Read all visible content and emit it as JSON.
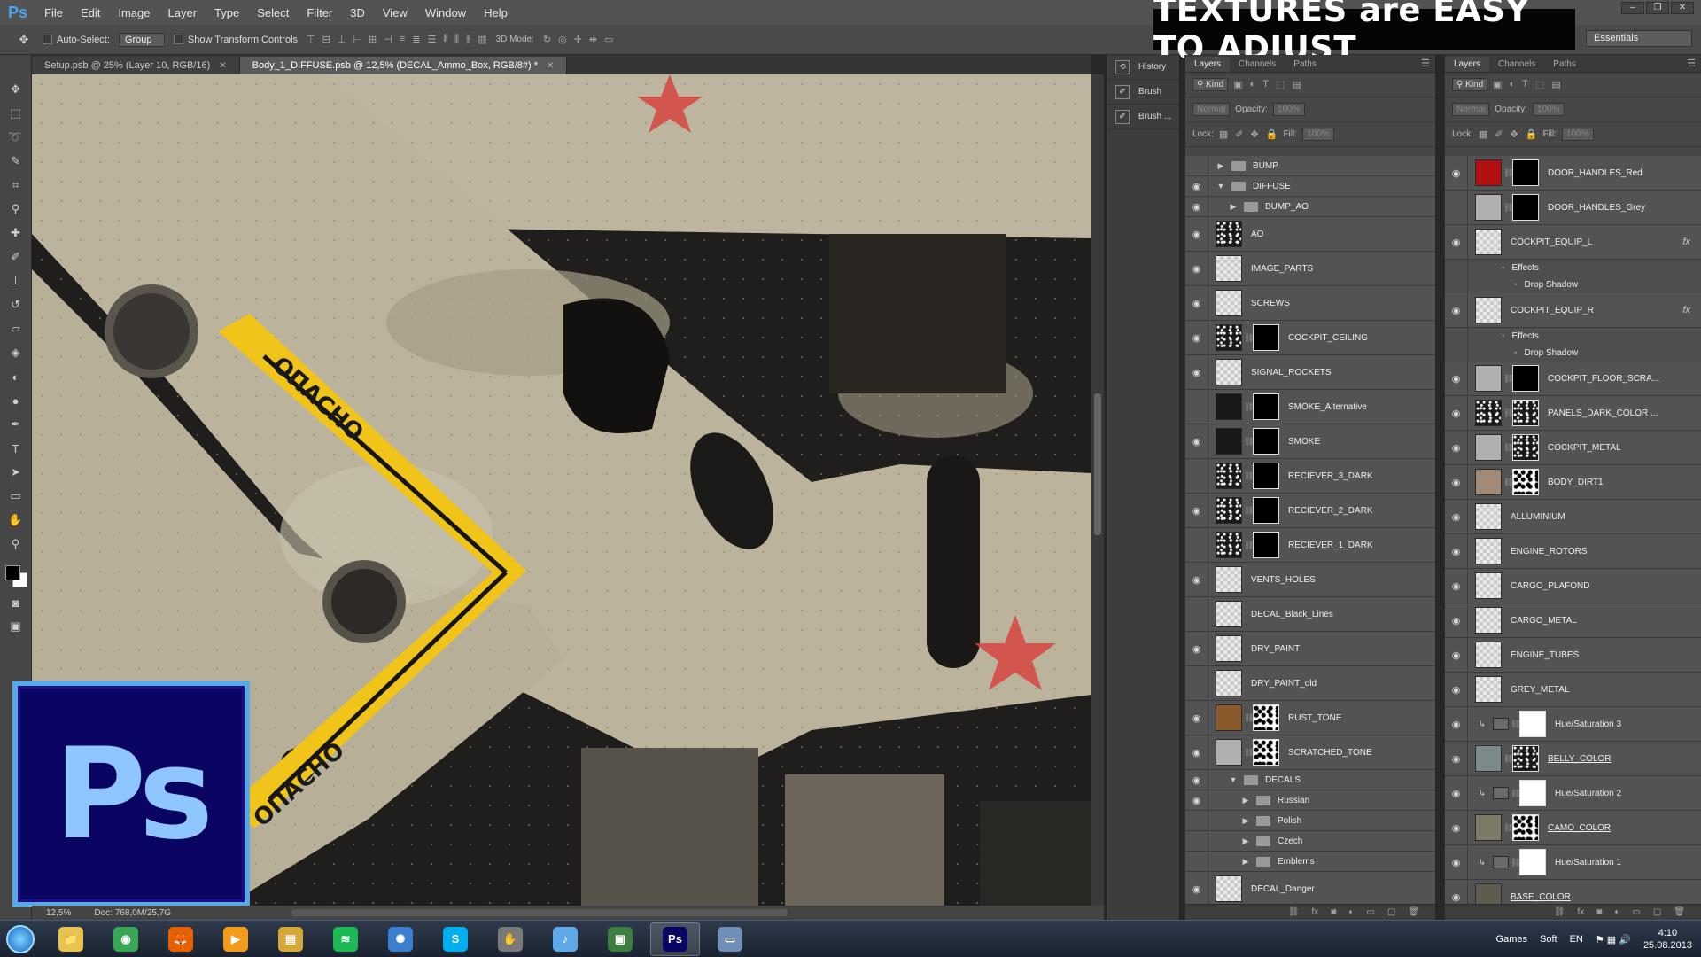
{
  "app": {
    "logo": "Ps"
  },
  "menubar": {
    "items": [
      "File",
      "Edit",
      "Image",
      "Layer",
      "Type",
      "Select",
      "Filter",
      "3D",
      "View",
      "Window",
      "Help"
    ]
  },
  "banner": {
    "text": "TEXTURES are EASY TO ADJUST"
  },
  "window_controls": {
    "minimize": "–",
    "restore": "❐",
    "close": "✕"
  },
  "options_bar": {
    "auto_select_label": "Auto-Select:",
    "auto_select_value": "Group",
    "show_transform_label": "Show Transform Controls",
    "mode_3d_label": "3D Mode:",
    "workspace": "Essentials"
  },
  "doc_tabs": [
    {
      "label": "Setup.psb @ 25% (Layer 10, RGB/16)",
      "active": false
    },
    {
      "label": "Body_1_DIFFUSE.psb @ 12,5% (DECAL_Ammo_Box, RGB/8#) *",
      "active": true
    }
  ],
  "canvas": {
    "stencil_top": "ОПАСНО",
    "stencil_bottom": "ОПАСНО",
    "colors": {
      "hull": "#bdb59f",
      "hull_dark": "#a49d88",
      "shadow": "#1f1e1c",
      "stripe": "#f0c419",
      "star": "#d6453f"
    }
  },
  "status_bar": {
    "zoom": "12,5%",
    "doc": "Doc: 768,0M/25,7G"
  },
  "mini_panel": {
    "items": [
      {
        "label": "History",
        "icon": "history-icon"
      },
      {
        "label": "Brush",
        "icon": "brush-icon"
      },
      {
        "label": "Brush ...",
        "icon": "brush-presets-icon"
      }
    ]
  },
  "panel1": {
    "tabs": [
      "Layers",
      "Channels",
      "Paths"
    ],
    "filter_kind": "Kind",
    "blend_mode": "Normal",
    "opacity_label": "Opacity:",
    "opacity_value": "100%",
    "lock_label": "Lock:",
    "fill_label": "Fill:",
    "fill_value": "100%",
    "layers": [
      {
        "name": "BUMP",
        "kind": "group",
        "visible": false,
        "indent": 0,
        "expanded": false
      },
      {
        "name": "DIFFUSE",
        "kind": "group",
        "visible": true,
        "indent": 0,
        "expanded": true
      },
      {
        "name": "BUMP_AO",
        "kind": "group",
        "visible": true,
        "indent": 1,
        "expanded": false
      },
      {
        "name": "AO",
        "kind": "layer",
        "visible": true,
        "thumb": "noise"
      },
      {
        "name": "IMAGE_PARTS",
        "kind": "layer",
        "visible": true,
        "thumb": "checker"
      },
      {
        "name": "SCREWS",
        "kind": "layer",
        "visible": true,
        "thumb": "checker"
      },
      {
        "name": "COCKPIT_CEILING",
        "kind": "layer",
        "visible": true,
        "thumb": "noise",
        "mask": "black"
      },
      {
        "name": "SIGNAL_ROCKETS",
        "kind": "layer",
        "visible": true,
        "thumb": "checker"
      },
      {
        "name": "SMOKE_Alternative",
        "kind": "layer",
        "visible": false,
        "thumb": "dark",
        "mask": "black"
      },
      {
        "name": "SMOKE",
        "kind": "layer",
        "visible": true,
        "thumb": "dark",
        "mask": "black"
      },
      {
        "name": "RECIEVER_3_DARK",
        "kind": "layer",
        "visible": false,
        "thumb": "noise",
        "mask": "black"
      },
      {
        "name": "RECIEVER_2_DARK",
        "kind": "layer",
        "visible": true,
        "thumb": "noise",
        "mask": "black"
      },
      {
        "name": "RECIEVER_1_DARK",
        "kind": "layer",
        "visible": false,
        "thumb": "noise",
        "mask": "black"
      },
      {
        "name": "VENTS_HOLES",
        "kind": "layer",
        "visible": true,
        "thumb": "checker"
      },
      {
        "name": "DECAL_Black_Lines",
        "kind": "layer",
        "visible": false,
        "thumb": "checker"
      },
      {
        "name": "DRY_PAINT",
        "kind": "layer",
        "visible": true,
        "thumb": "checker"
      },
      {
        "name": "DRY_PAINT_old",
        "kind": "layer",
        "visible": false,
        "thumb": "checker"
      },
      {
        "name": "RUST_TONE",
        "kind": "layer",
        "visible": true,
        "thumb": "rust",
        "mask": "noise"
      },
      {
        "name": "SCRATCHED_TONE",
        "kind": "layer",
        "visible": true,
        "thumb": "grey",
        "mask": "noise"
      },
      {
        "name": "DECALS",
        "kind": "group",
        "visible": true,
        "indent": 1,
        "expanded": true
      },
      {
        "name": "Russian",
        "kind": "group",
        "visible": true,
        "indent": 2,
        "expanded": false
      },
      {
        "name": "Polish",
        "kind": "group",
        "visible": false,
        "indent": 2,
        "expanded": false
      },
      {
        "name": "Czech",
        "kind": "group",
        "visible": false,
        "indent": 2,
        "expanded": false
      },
      {
        "name": "Emblems",
        "kind": "group",
        "visible": false,
        "indent": 2,
        "expanded": false
      },
      {
        "name": "DECAL_Danger",
        "kind": "layer",
        "visible": true,
        "thumb": "checker"
      }
    ]
  },
  "panel2": {
    "tabs": [
      "Layers",
      "Channels",
      "Paths"
    ],
    "filter_kind": "Kind",
    "blend_mode": "Normal",
    "opacity_label": "Opacity:",
    "opacity_value": "100%",
    "lock_label": "Lock:",
    "fill_label": "Fill:",
    "fill_value": "100%",
    "effects_label": "Effects",
    "drop_shadow_label": "Drop Shadow",
    "layers": [
      {
        "name": "DOOR_HANDLES_Red",
        "kind": "layer",
        "visible": true,
        "thumb": "red",
        "mask": "black"
      },
      {
        "name": "DOOR_HANDLES_Grey",
        "kind": "layer",
        "visible": false,
        "thumb": "grey",
        "mask": "black"
      },
      {
        "name": "COCKPIT_EQUIP_L",
        "kind": "layer",
        "visible": true,
        "thumb": "checker",
        "fx": true
      },
      {
        "name": "Effects",
        "kind": "effects",
        "visible": false
      },
      {
        "name": "Drop Shadow",
        "kind": "effects",
        "visible": false,
        "indent": 1
      },
      {
        "name": "COCKPIT_EQUIP_R",
        "kind": "layer",
        "visible": true,
        "thumb": "checker",
        "fx": true
      },
      {
        "name": "Effects",
        "kind": "effects",
        "visible": false
      },
      {
        "name": "Drop Shadow",
        "kind": "effects",
        "visible": false,
        "indent": 1
      },
      {
        "name": "COCKPIT_FLOOR_SCRA...",
        "kind": "layer",
        "visible": true,
        "thumb": "grey",
        "mask": "black"
      },
      {
        "name": "PANELS_DARK_COLOR ...",
        "kind": "layer",
        "visible": true,
        "thumb": "noise",
        "mask": "noise-inv"
      },
      {
        "name": "COCKPIT_METAL",
        "kind": "layer",
        "visible": true,
        "thumb": "grey",
        "mask": "noise-inv"
      },
      {
        "name": "BODY_DIRT1",
        "kind": "layer",
        "visible": true,
        "thumb": "dirt",
        "mask": "noise"
      },
      {
        "name": "ALLUMINIUM",
        "kind": "layer",
        "visible": true,
        "thumb": "checker"
      },
      {
        "name": "ENGINE_ROTORS",
        "kind": "layer",
        "visible": true,
        "thumb": "checker"
      },
      {
        "name": "CARGO_PLAFOND",
        "kind": "layer",
        "visible": true,
        "thumb": "checker"
      },
      {
        "name": "CARGO_METAL",
        "kind": "layer",
        "visible": true,
        "thumb": "checker"
      },
      {
        "name": "ENGINE_TUBES",
        "kind": "layer",
        "visible": true,
        "thumb": "checker"
      },
      {
        "name": "GREY_METAL",
        "kind": "layer",
        "visible": true,
        "thumb": "checker"
      },
      {
        "name": "Hue/Saturation 3",
        "kind": "adjustment",
        "visible": true,
        "mask": "white"
      },
      {
        "name": "BELLY_COLOR",
        "kind": "layer",
        "visible": true,
        "thumb": "belly",
        "mask": "noise-inv",
        "underline": true
      },
      {
        "name": "Hue/Saturation 2",
        "kind": "adjustment",
        "visible": true,
        "mask": "white"
      },
      {
        "name": "CAMO_COLOR",
        "kind": "layer",
        "visible": true,
        "thumb": "camo",
        "mask": "noise",
        "underline": true
      },
      {
        "name": "Hue/Saturation 1",
        "kind": "adjustment",
        "visible": true,
        "mask": "white"
      },
      {
        "name": "BASE_COLOR",
        "kind": "layer",
        "visible": true,
        "thumb": "base",
        "underline": true
      }
    ]
  },
  "taskbar": {
    "apps": [
      {
        "name": "explorer",
        "label": "📁",
        "color": "#e9c34f"
      },
      {
        "name": "chrome",
        "label": "◉",
        "color": "#3aa757"
      },
      {
        "name": "firefox",
        "label": "🦊",
        "color": "#e66000"
      },
      {
        "name": "media-player",
        "label": "▶",
        "color": "#f29b1d"
      },
      {
        "name": "file-manager",
        "label": "▤",
        "color": "#d4a93a"
      },
      {
        "name": "spotify",
        "label": "≋",
        "color": "#1db954"
      },
      {
        "name": "app-circle",
        "label": "✺",
        "color": "#3c7fd1"
      },
      {
        "name": "skype",
        "label": "S",
        "color": "#00aff0"
      },
      {
        "name": "tool",
        "label": "✋",
        "color": "#7a7a7a"
      },
      {
        "name": "itunes",
        "label": "♪",
        "color": "#5fa8e8"
      },
      {
        "name": "terminal",
        "label": "▣",
        "color": "#3d7d3d"
      },
      {
        "name": "photoshop",
        "label": "Ps",
        "color": "#0a0463",
        "active": true
      },
      {
        "name": "window",
        "label": "▭",
        "color": "#6f8fb8"
      }
    ],
    "tray_games": "Games",
    "tray_soft": "Soft",
    "language": "EN",
    "time": "4:10",
    "date": "25.08.2013"
  }
}
